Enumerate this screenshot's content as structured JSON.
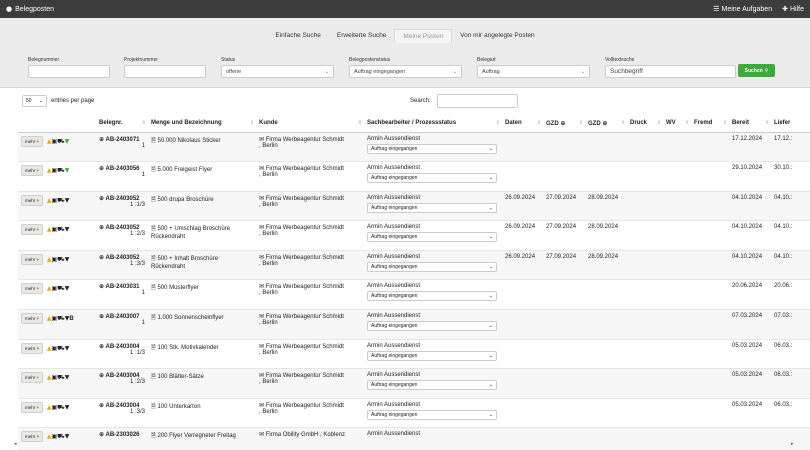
{
  "topbar": {
    "title": "Belegposten",
    "my_tasks": "Meine Aufgaben",
    "help": "Hilfe"
  },
  "tabs": [
    {
      "label": "Einfache Suche",
      "active": false
    },
    {
      "label": "Erweiterte Suche",
      "active": false
    },
    {
      "label": "Meine Posten",
      "active": true
    },
    {
      "label": "Von mir angelegte Posten",
      "active": false
    }
  ],
  "filters": {
    "belegnummer": {
      "label": "Belegnummer",
      "value": ""
    },
    "projektnummer": {
      "label": "Projektnummer",
      "value": ""
    },
    "status": {
      "label": "Status",
      "value": "offene"
    },
    "belegpostenstatus": {
      "label": "Belegpostenstatus",
      "value": "Auftrag eingegangen"
    },
    "belegart": {
      "label": "Belegart",
      "value": "Auftrag"
    },
    "volltextsuche": {
      "label": "Volltextsuche",
      "value": "Suchbegriff"
    },
    "search_button": "Suchen"
  },
  "table_controls": {
    "page_size": "50",
    "entries_label": "entries per page",
    "search_label": "Search:"
  },
  "columns": [
    "",
    "Belegnr.",
    "Menge und Bezeichnung",
    "Kunde",
    "Sachbearbeiter / Prozessstatus",
    "Daten",
    "GZD",
    "GZD",
    "Druck",
    "WV",
    "Fremd",
    "Bereit",
    "Liefer"
  ],
  "mehr_label": "mehr",
  "rows": [
    {
      "nr": "AB-2403071",
      "sub": "1",
      "menge": "50.000 Nikolaus Sticker",
      "menge2": "",
      "extra": "",
      "kunde": "Firma Werbeagentur Schmidt",
      "ort": ", Berlin",
      "sb": "Armin Aussendienst",
      "status": "Auftrag eingegangen",
      "daten": "",
      "gzd1": "",
      "gzd2": "",
      "bereit": "17.12.2024",
      "liefer": "17.12.:"
    },
    {
      "nr": "AB-2403056",
      "sub": "1",
      "menge": "5.000 Freigeist Flyer",
      "menge2": "",
      "extra": "",
      "kunde": "Firma Werbeagentur Schmidt",
      "ort": ", Berlin",
      "sb": "Armin Aussendienst",
      "status": "Auftrag eingegangen",
      "daten": "",
      "gzd1": "",
      "gzd2": "",
      "bereit": "29.10.2024",
      "liefer": "30.10.:"
    },
    {
      "nr": "AB-2403052",
      "sub": "1 :1/3",
      "menge": "500 drupa Broschüre",
      "menge2": "",
      "extra": "",
      "kunde": "Firma Werbeagentur Schmidt",
      "ort": ", Berlin",
      "sb": "Armin Aussendienst",
      "status": "Auftrag eingegangen",
      "daten": "26.09.2024",
      "gzd1": "27.09.2024",
      "gzd2": "28.09.2024",
      "bereit": "04.10.2024",
      "liefer": "04.10.:"
    },
    {
      "nr": "AB-2403052",
      "sub": "1 :2/3",
      "menge": "500 + Umschlag Broschüre",
      "menge2": "Rückendraht",
      "extra": "",
      "kunde": "Firma Werbeagentur Schmidt",
      "ort": ", Berlin",
      "sb": "Armin Aussendienst",
      "status": "Auftrag eingegangen",
      "daten": "26.09.2024",
      "gzd1": "27.09.2024",
      "gzd2": "28.09.2024",
      "bereit": "04.10.2024",
      "liefer": "04.10.:"
    },
    {
      "nr": "AB-2403052",
      "sub": "1 :3/3",
      "menge": "500 + Inhalt Broschüre",
      "menge2": "Rückendraht",
      "extra": "",
      "kunde": "Firma Werbeagentur Schmidt",
      "ort": ", Berlin",
      "sb": "Armin Aussendienst",
      "status": "Auftrag eingegangen",
      "daten": "26.09.2024",
      "gzd1": "27.09.2024",
      "gzd2": "28.09.2024",
      "bereit": "04.10.2024",
      "liefer": "04.10.:"
    },
    {
      "nr": "AB-2403031",
      "sub": "1",
      "menge": "500 Musterflyer",
      "menge2": "",
      "extra": "",
      "kunde": "Firma Werbeagentur Schmidt",
      "ort": ", Berlin",
      "sb": "Armin Aussendienst",
      "status": "Auftrag eingegangen",
      "daten": "",
      "gzd1": "",
      "gzd2": "",
      "bereit": "20.06.2024",
      "liefer": "20.06.:"
    },
    {
      "nr": "AB-2403007",
      "sub": "1",
      "menge": "1.000 Sonnenscheinflyer",
      "menge2": "",
      "extra": "B",
      "kunde": "Firma Werbeagentur Schmidt",
      "ort": ", Berlin",
      "sb": "Armin Aussendienst",
      "status": "Auftrag eingegangen",
      "daten": "",
      "gzd1": "",
      "gzd2": "",
      "bereit": "07.03.2024",
      "liefer": "07.03.:"
    },
    {
      "nr": "AB-2403004",
      "sub": "1 :1/3",
      "menge": "100 Stk. Motivkalender",
      "menge2": "",
      "extra": "",
      "kunde": "Firma Werbeagentur Schmidt",
      "ort": ", Berlin",
      "sb": "Armin Aussendienst",
      "status": "Auftrag eingegangen",
      "daten": "",
      "gzd1": "",
      "gzd2": "",
      "bereit": "05.03.2024",
      "liefer": "06.03.:"
    },
    {
      "nr": "AB-2403004",
      "sub": "1 :2/3",
      "menge": "100 Blätter-Sätze",
      "menge2": "",
      "extra": "",
      "kunde": "Firma Werbeagentur Schmidt",
      "ort": ", Berlin",
      "sb": "Armin Aussendienst",
      "status": "Auftrag eingegangen",
      "daten": "",
      "gzd1": "",
      "gzd2": "",
      "bereit": "05.03.2024",
      "liefer": "06.03.:"
    },
    {
      "nr": "AB-2403004",
      "sub": "1 :3/3",
      "menge": "100 Unterkarton",
      "menge2": "",
      "extra": "",
      "kunde": "Firma Werbeagentur Schmidt",
      "ort": ", Berlin",
      "sb": "Armin Aussendienst",
      "status": "Auftrag eingegangen",
      "daten": "",
      "gzd1": "",
      "gzd2": "",
      "bereit": "05.03.2024",
      "liefer": "06.03.:"
    },
    {
      "nr": "AB-2303026",
      "sub": "",
      "menge": "200 Flyer Verregneter Freitag",
      "menge2": "",
      "extra": "",
      "kunde": "Firma Obility GmbH , Koblenz",
      "ort": "",
      "sb": "Armin Aussendienst",
      "status": "",
      "daten": "",
      "gzd1": "",
      "gzd2": "",
      "bereit": "",
      "liefer": ""
    }
  ]
}
